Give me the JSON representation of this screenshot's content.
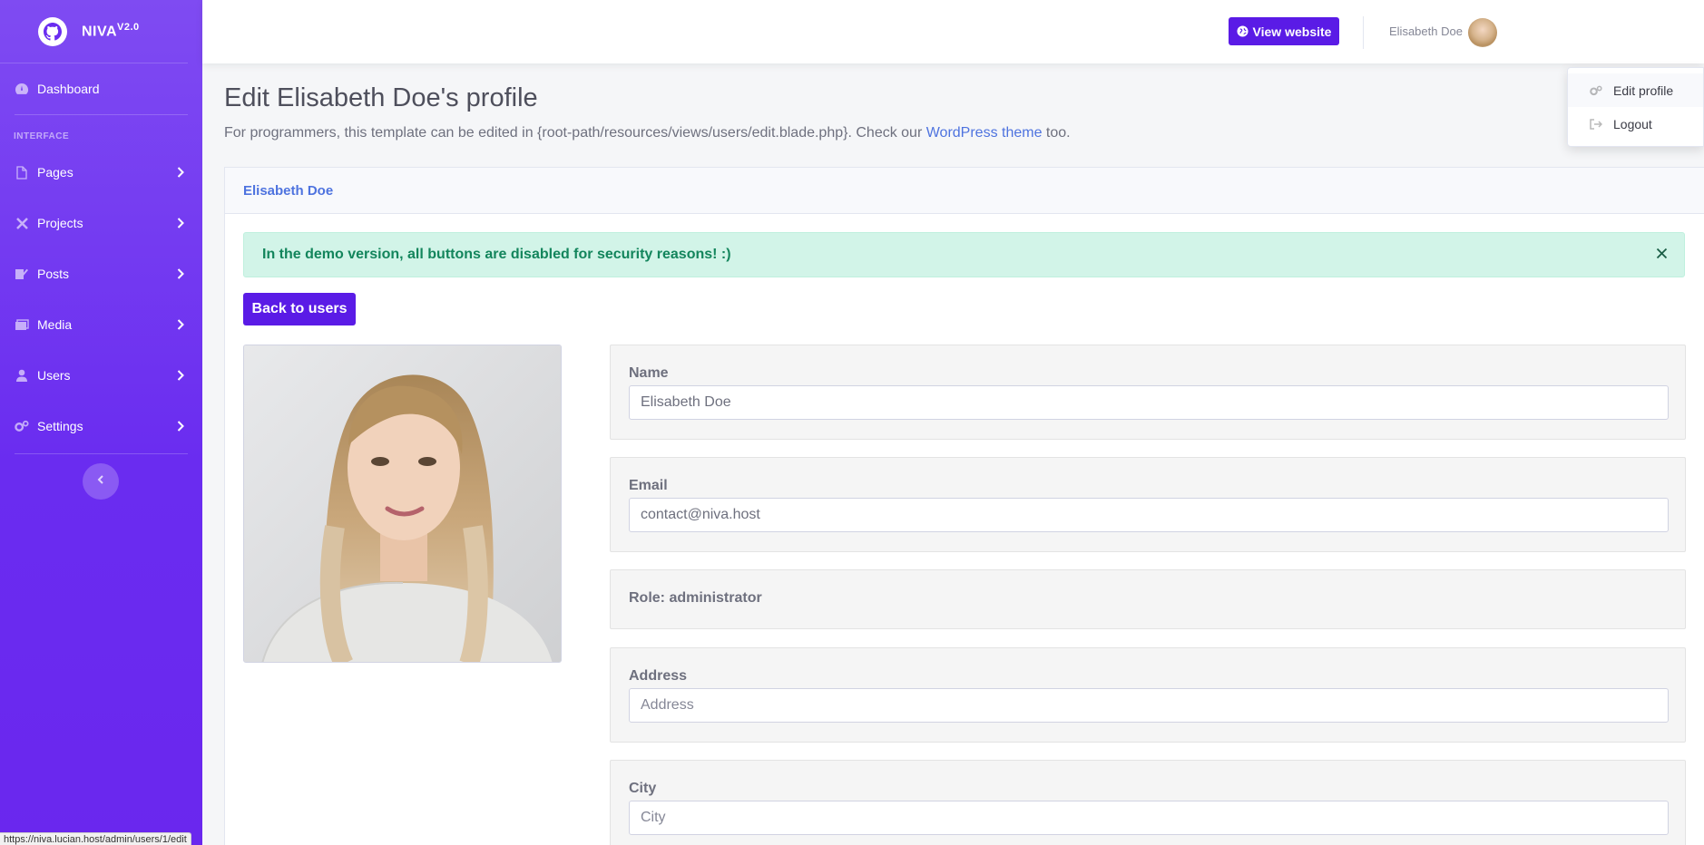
{
  "brand": {
    "name": "NIVA",
    "version": "V2.0"
  },
  "sidebar": {
    "dashboard": "Dashboard",
    "heading": "INTERFACE",
    "items": [
      {
        "label": "Pages",
        "icon": "file-icon"
      },
      {
        "label": "Projects",
        "icon": "tools-icon"
      },
      {
        "label": "Posts",
        "icon": "pencil-icon"
      },
      {
        "label": "Media",
        "icon": "images-icon"
      },
      {
        "label": "Users",
        "icon": "user-icon"
      },
      {
        "label": "Settings",
        "icon": "cogs-icon"
      }
    ]
  },
  "topbar": {
    "view_website": "View website",
    "user_name": "Elisabeth Doe"
  },
  "dropdown": {
    "edit_profile": "Edit profile",
    "logout": "Logout"
  },
  "page": {
    "title": "Edit Elisabeth Doe's profile",
    "subtitle_prefix": "For programmers, this template can be edited in {root-path/resources/views/users/edit.blade.php}. Check our ",
    "subtitle_link": "WordPress theme",
    "subtitle_suffix": " too."
  },
  "card": {
    "header": "Elisabeth Doe",
    "alert": "In the demo version, all buttons are disabled for security reasons! :)",
    "back_button": "Back to users"
  },
  "form": {
    "name_label": "Name",
    "name_value": "Elisabeth Doe",
    "email_label": "Email",
    "email_value": "contact@niva.host",
    "role_text": "Role: administrator",
    "address_label": "Address",
    "address_placeholder": "Address",
    "city_label": "City",
    "city_placeholder": "City"
  },
  "status_bar": {
    "url": "https://niva.lucian.host/admin/users/1/edit"
  },
  "colors": {
    "sidebar": "#6a2cf0",
    "primary_button": "#5a1be6",
    "link": "#4e73df",
    "alert_bg": "#d2f4e8",
    "alert_text": "#13855c"
  }
}
